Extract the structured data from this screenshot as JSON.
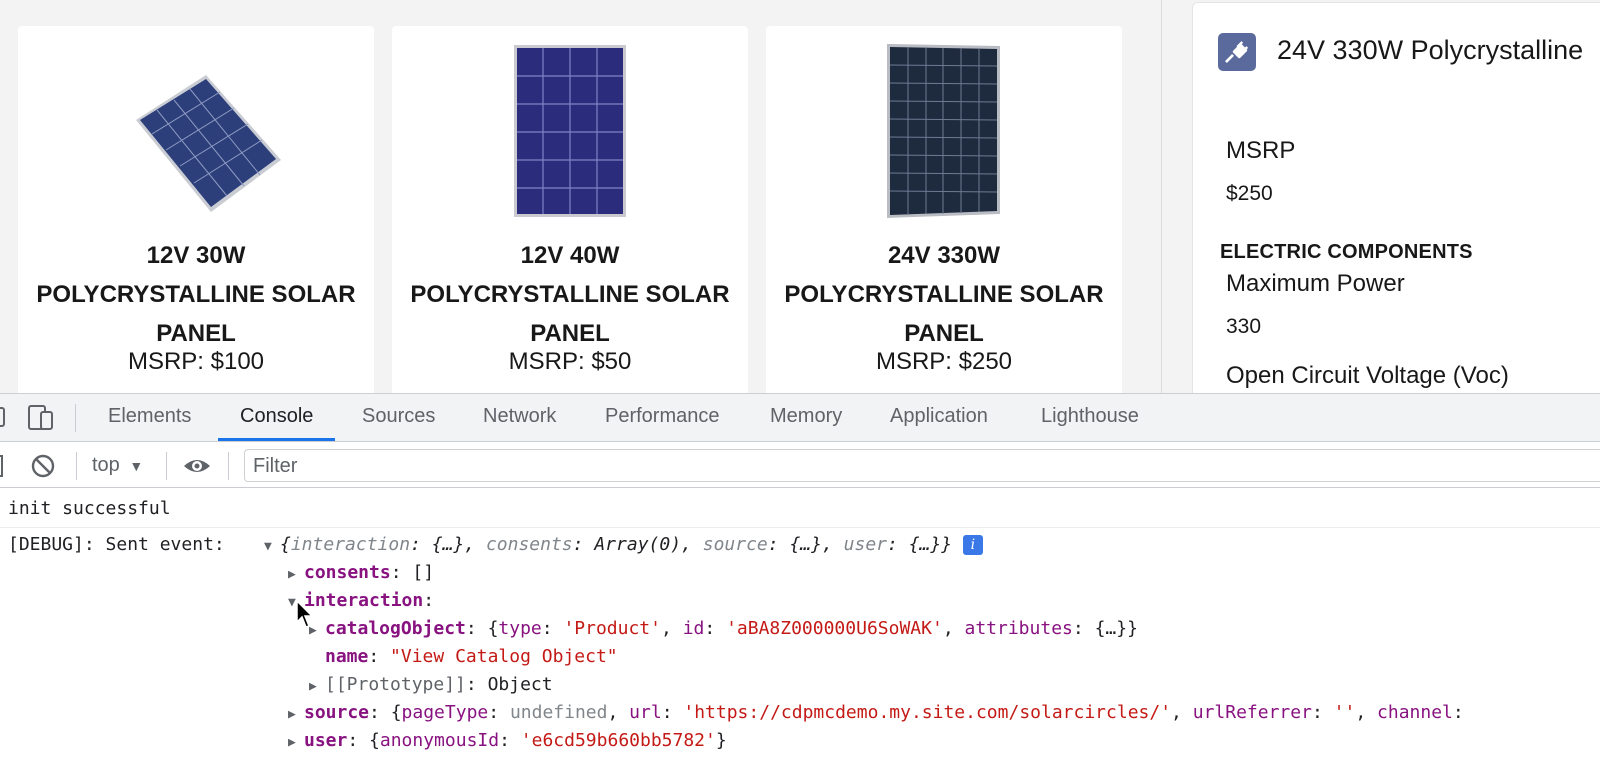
{
  "products": [
    {
      "title": "12V 30W POLYCRYSTALLINE SOLAR PANEL",
      "title_lines": [
        "12V 30W",
        "POLYCRYSTALLINE SOLAR",
        "PANEL"
      ],
      "price": "MSRP: $100"
    },
    {
      "title": "12V 40W POLYCRYSTALLINE SOLAR PANEL",
      "title_lines": [
        "12V 40W",
        "POLYCRYSTALLINE SOLAR",
        "PANEL"
      ],
      "price": "MSRP: $50"
    },
    {
      "title": "24V 330W POLYCRYSTALLINE SOLAR PANEL",
      "title_lines": [
        "24V 330W",
        "POLYCRYSTALLINE SOLAR",
        "PANEL"
      ],
      "price": "MSRP: $250"
    }
  ],
  "detail": {
    "icon": "plug-icon",
    "title": "24V 330W Polycrystalline",
    "msrp_label": "MSRP",
    "msrp_value": "$250",
    "section": "ELECTRIC COMPONENTS",
    "max_power_label": "Maximum Power",
    "max_power_value": "330",
    "voc_label": "Open Circuit Voltage (Voc)"
  },
  "devtools": {
    "tabs": [
      "Elements",
      "Console",
      "Sources",
      "Network",
      "Performance",
      "Memory",
      "Application",
      "Lighthouse"
    ],
    "active_tab": "Console",
    "context": "top",
    "filter_placeholder": "Filter"
  },
  "console": {
    "init": "init successful",
    "debug_prefix": "[DEBUG]: Sent event:",
    "summary": {
      "k1": "interaction",
      "v1": "{…}",
      "k2": "consents",
      "v2": "Array(0)",
      "k3": "source",
      "v3": "{…}",
      "k4": "user",
      "v4": "{…}"
    },
    "consents": {
      "key": "consents",
      "value": "[]"
    },
    "interaction": {
      "key": "interaction"
    },
    "catalogObject": {
      "key": "catalogObject",
      "type_key": "type",
      "type_value": "'Product'",
      "id_key": "id",
      "id_value": "'aBA8Z000000U6SoWAK'",
      "attr_key": "attributes",
      "attr_value": "{…}"
    },
    "name": {
      "key": "name",
      "value": "\"View Catalog Object\""
    },
    "prototype": {
      "key": "[[Prototype]]",
      "value": "Object"
    },
    "source": {
      "key": "source",
      "pageType_key": "pageType",
      "pageType_value": "undefined",
      "url_key": "url",
      "url_value": "'https://cdpmcdemo.my.site.com/solarcircles/'",
      "ref_key": "urlReferrer",
      "ref_value": "''",
      "channel_key": "channel"
    },
    "user": {
      "key": "user",
      "anon_key": "anonymousId",
      "anon_value": "'e6cd59b660bb5782'"
    }
  }
}
